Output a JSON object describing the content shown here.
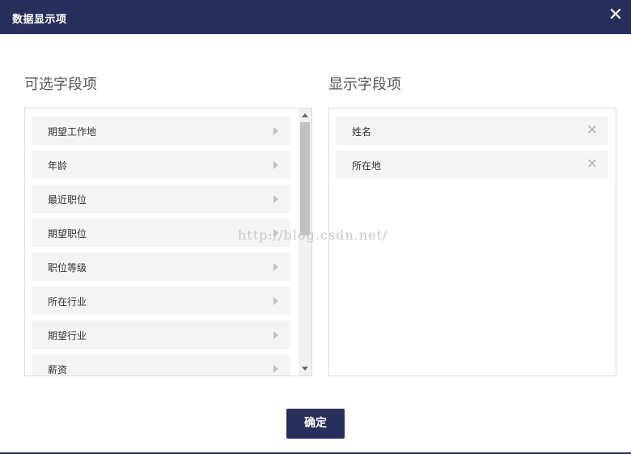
{
  "dialog": {
    "title": "数据显示项",
    "close_icon": "close-icon",
    "close_glyph": "✕"
  },
  "available": {
    "heading": "可选字段项",
    "items": [
      {
        "label": "期望工作地"
      },
      {
        "label": "年龄"
      },
      {
        "label": "最近职位"
      },
      {
        "label": "期望职位"
      },
      {
        "label": "职位等级"
      },
      {
        "label": "所在行业"
      },
      {
        "label": "期望行业"
      },
      {
        "label": "薪资"
      }
    ]
  },
  "selected": {
    "heading": "显示字段项",
    "remove_glyph": "✕",
    "items": [
      {
        "label": "姓名"
      },
      {
        "label": "所在地"
      }
    ]
  },
  "watermark": "http://blog.csdn.net/",
  "footer": {
    "confirm_label": "确定"
  },
  "colors": {
    "primary": "#282f5a",
    "item_bg": "#f4f4f4",
    "border": "#dcdcdc"
  }
}
